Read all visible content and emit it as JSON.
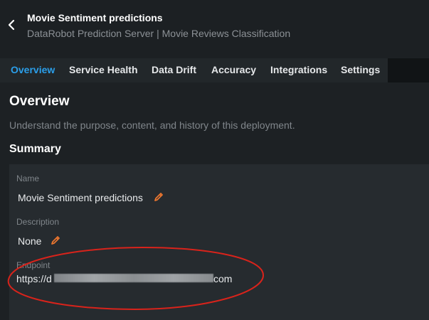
{
  "header": {
    "title": "Movie Sentiment predictions",
    "subtitle": "DataRobot Prediction Server | Movie Reviews Classification"
  },
  "tabs": [
    {
      "label": "Overview"
    },
    {
      "label": "Service Health"
    },
    {
      "label": "Data Drift"
    },
    {
      "label": "Accuracy"
    },
    {
      "label": "Integrations"
    },
    {
      "label": "Settings"
    }
  ],
  "page": {
    "title": "Overview",
    "description": "Understand the purpose, content, and history of this deployment.",
    "summary_title": "Summary"
  },
  "summary": {
    "name_label": "Name",
    "name_value": "Movie Sentiment predictions",
    "description_label": "Description",
    "description_value": "None",
    "endpoint_label": "Endpoint",
    "endpoint_prefix": "https://d",
    "endpoint_suffix": "com"
  },
  "colors": {
    "accent": "#2b9fea",
    "edit_icon": "#e8752f",
    "annotation": "#d9231b"
  },
  "icons": {
    "back": "chevron-left-icon",
    "edit": "pencil-icon"
  }
}
